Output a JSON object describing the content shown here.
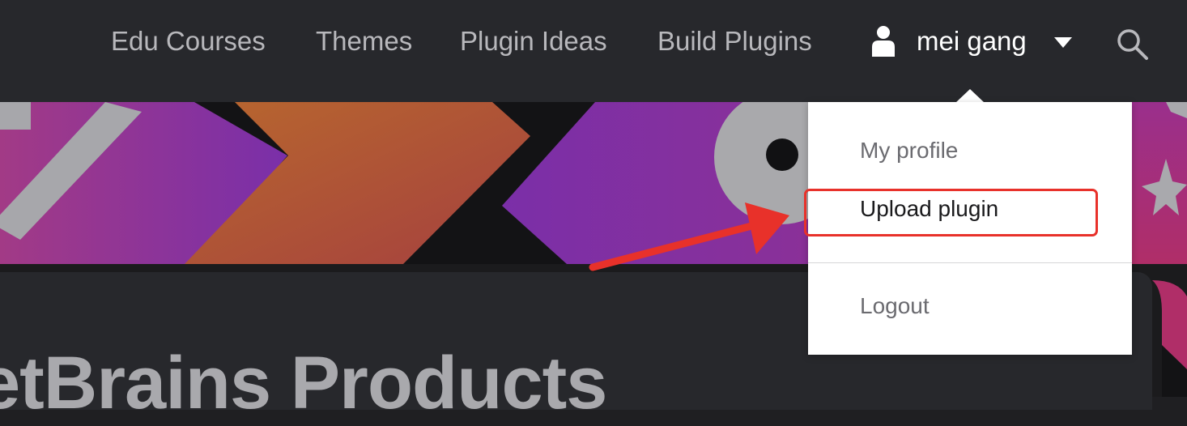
{
  "nav": {
    "links": [
      {
        "label": "Edu Courses"
      },
      {
        "label": "Themes"
      },
      {
        "label": "Plugin Ideas"
      },
      {
        "label": "Build Plugins"
      }
    ],
    "user_name": "mei gang",
    "user_icon": "person-icon",
    "dropdown_icon": "caret-down-icon",
    "search_icon": "search-icon"
  },
  "dropdown": {
    "items": [
      {
        "label": "My profile"
      },
      {
        "label": "Upload plugin",
        "highlighted": true
      },
      {
        "label": "Logout"
      }
    ]
  },
  "hero": {
    "title": "etBrains Products"
  },
  "colors": {
    "nav_background": "#27282c",
    "page_background": "#1b1b1d",
    "annotation_red": "#e8312a",
    "banner_purple": "#7b2fa8",
    "banner_orange": "#b05a3a"
  }
}
